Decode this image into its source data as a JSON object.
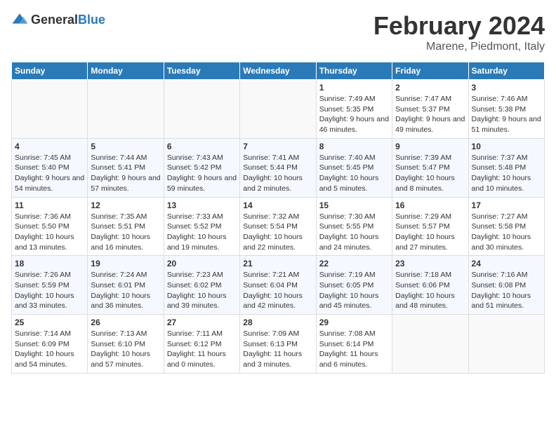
{
  "header": {
    "logo_general": "General",
    "logo_blue": "Blue",
    "title": "February 2024",
    "subtitle": "Marene, Piedmont, Italy"
  },
  "weekdays": [
    "Sunday",
    "Monday",
    "Tuesday",
    "Wednesday",
    "Thursday",
    "Friday",
    "Saturday"
  ],
  "weeks": [
    [
      {
        "day": "",
        "info": ""
      },
      {
        "day": "",
        "info": ""
      },
      {
        "day": "",
        "info": ""
      },
      {
        "day": "",
        "info": ""
      },
      {
        "day": "1",
        "info": "Sunrise: 7:49 AM\nSunset: 5:35 PM\nDaylight: 9 hours and 46 minutes."
      },
      {
        "day": "2",
        "info": "Sunrise: 7:47 AM\nSunset: 5:37 PM\nDaylight: 9 hours and 49 minutes."
      },
      {
        "day": "3",
        "info": "Sunrise: 7:46 AM\nSunset: 5:38 PM\nDaylight: 9 hours and 51 minutes."
      }
    ],
    [
      {
        "day": "4",
        "info": "Sunrise: 7:45 AM\nSunset: 5:40 PM\nDaylight: 9 hours and 54 minutes."
      },
      {
        "day": "5",
        "info": "Sunrise: 7:44 AM\nSunset: 5:41 PM\nDaylight: 9 hours and 57 minutes."
      },
      {
        "day": "6",
        "info": "Sunrise: 7:43 AM\nSunset: 5:42 PM\nDaylight: 9 hours and 59 minutes."
      },
      {
        "day": "7",
        "info": "Sunrise: 7:41 AM\nSunset: 5:44 PM\nDaylight: 10 hours and 2 minutes."
      },
      {
        "day": "8",
        "info": "Sunrise: 7:40 AM\nSunset: 5:45 PM\nDaylight: 10 hours and 5 minutes."
      },
      {
        "day": "9",
        "info": "Sunrise: 7:39 AM\nSunset: 5:47 PM\nDaylight: 10 hours and 8 minutes."
      },
      {
        "day": "10",
        "info": "Sunrise: 7:37 AM\nSunset: 5:48 PM\nDaylight: 10 hours and 10 minutes."
      }
    ],
    [
      {
        "day": "11",
        "info": "Sunrise: 7:36 AM\nSunset: 5:50 PM\nDaylight: 10 hours and 13 minutes."
      },
      {
        "day": "12",
        "info": "Sunrise: 7:35 AM\nSunset: 5:51 PM\nDaylight: 10 hours and 16 minutes."
      },
      {
        "day": "13",
        "info": "Sunrise: 7:33 AM\nSunset: 5:52 PM\nDaylight: 10 hours and 19 minutes."
      },
      {
        "day": "14",
        "info": "Sunrise: 7:32 AM\nSunset: 5:54 PM\nDaylight: 10 hours and 22 minutes."
      },
      {
        "day": "15",
        "info": "Sunrise: 7:30 AM\nSunset: 5:55 PM\nDaylight: 10 hours and 24 minutes."
      },
      {
        "day": "16",
        "info": "Sunrise: 7:29 AM\nSunset: 5:57 PM\nDaylight: 10 hours and 27 minutes."
      },
      {
        "day": "17",
        "info": "Sunrise: 7:27 AM\nSunset: 5:58 PM\nDaylight: 10 hours and 30 minutes."
      }
    ],
    [
      {
        "day": "18",
        "info": "Sunrise: 7:26 AM\nSunset: 5:59 PM\nDaylight: 10 hours and 33 minutes."
      },
      {
        "day": "19",
        "info": "Sunrise: 7:24 AM\nSunset: 6:01 PM\nDaylight: 10 hours and 36 minutes."
      },
      {
        "day": "20",
        "info": "Sunrise: 7:23 AM\nSunset: 6:02 PM\nDaylight: 10 hours and 39 minutes."
      },
      {
        "day": "21",
        "info": "Sunrise: 7:21 AM\nSunset: 6:04 PM\nDaylight: 10 hours and 42 minutes."
      },
      {
        "day": "22",
        "info": "Sunrise: 7:19 AM\nSunset: 6:05 PM\nDaylight: 10 hours and 45 minutes."
      },
      {
        "day": "23",
        "info": "Sunrise: 7:18 AM\nSunset: 6:06 PM\nDaylight: 10 hours and 48 minutes."
      },
      {
        "day": "24",
        "info": "Sunrise: 7:16 AM\nSunset: 6:08 PM\nDaylight: 10 hours and 51 minutes."
      }
    ],
    [
      {
        "day": "25",
        "info": "Sunrise: 7:14 AM\nSunset: 6:09 PM\nDaylight: 10 hours and 54 minutes."
      },
      {
        "day": "26",
        "info": "Sunrise: 7:13 AM\nSunset: 6:10 PM\nDaylight: 10 hours and 57 minutes."
      },
      {
        "day": "27",
        "info": "Sunrise: 7:11 AM\nSunset: 6:12 PM\nDaylight: 11 hours and 0 minutes."
      },
      {
        "day": "28",
        "info": "Sunrise: 7:09 AM\nSunset: 6:13 PM\nDaylight: 11 hours and 3 minutes."
      },
      {
        "day": "29",
        "info": "Sunrise: 7:08 AM\nSunset: 6:14 PM\nDaylight: 11 hours and 6 minutes."
      },
      {
        "day": "",
        "info": ""
      },
      {
        "day": "",
        "info": ""
      }
    ]
  ]
}
